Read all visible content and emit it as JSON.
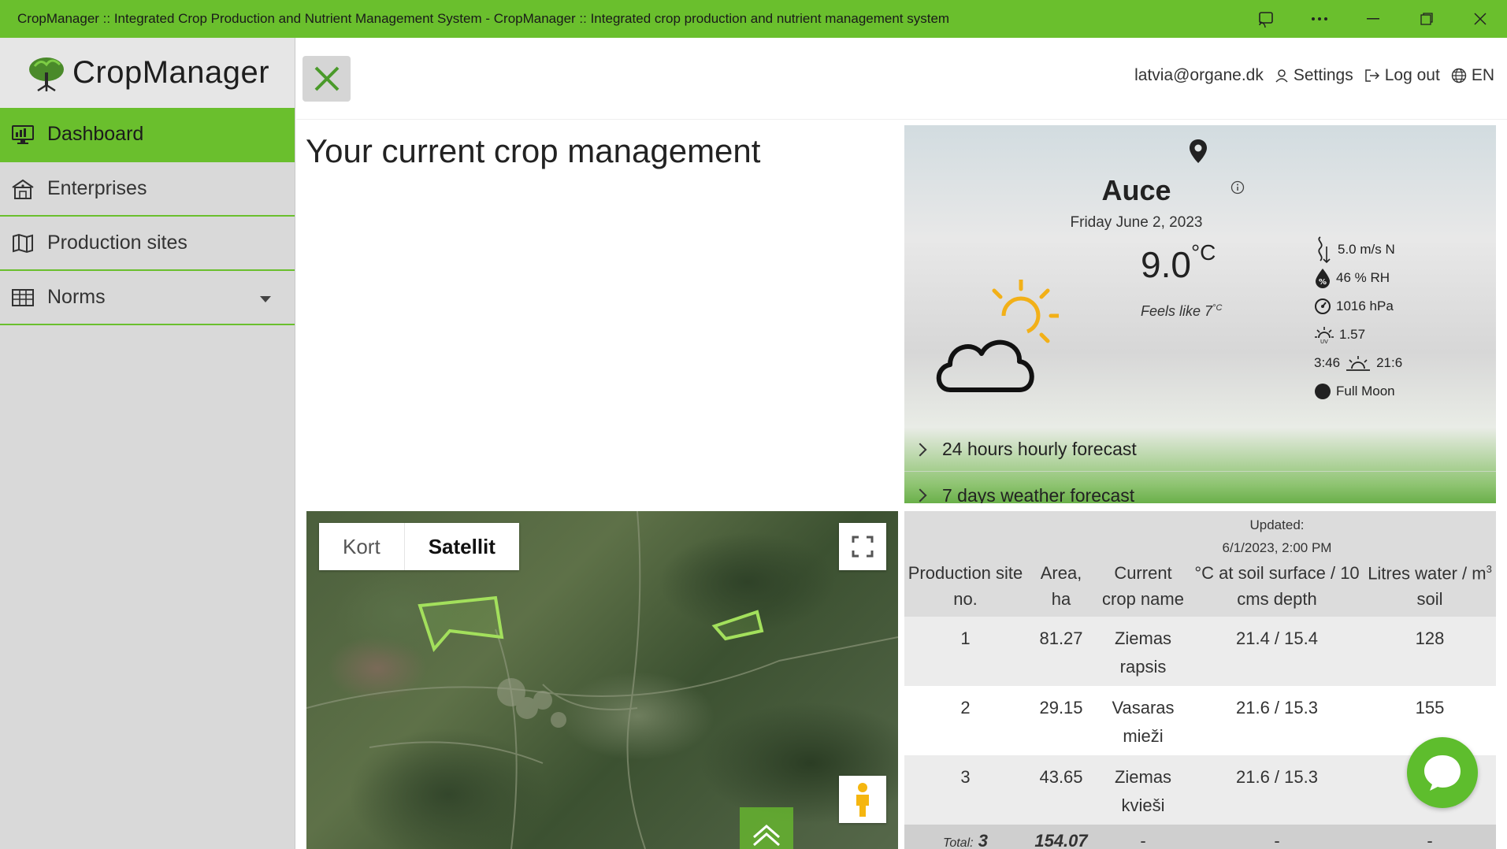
{
  "window": {
    "title": "CropManager :: Integrated Crop Production and Nutrient Management System - CropManager :: Integrated crop production and nutrient management system",
    "buttons": [
      "cast-icon",
      "more-icon",
      "minimize-icon",
      "maximize-icon",
      "close-icon"
    ]
  },
  "brand": {
    "name": "CropManager",
    "accent": "#6abf2d"
  },
  "sidebar": {
    "items": [
      {
        "label": "Dashboard",
        "icon": "dashboard-icon",
        "active": true
      },
      {
        "label": "Enterprises",
        "icon": "farm-icon"
      },
      {
        "label": "Production sites",
        "icon": "map-icon"
      },
      {
        "label": "Norms",
        "icon": "table-icon"
      }
    ]
  },
  "header": {
    "user": "latvia@organe.dk",
    "settings": "Settings",
    "logout": "Log out",
    "lang": "EN"
  },
  "page": {
    "title": "Your current crop management"
  },
  "weather": {
    "city": "Auce",
    "date": "Friday June 2, 2023",
    "temp": "9.0",
    "temp_unit": "°C",
    "feels_label": "Feels like 7",
    "feels_unit": "°C",
    "wind": "5.0 m/s N",
    "humidity": "46 % RH",
    "pressure": "1016 hPa",
    "uv": "1.57",
    "sunrise": "3:46",
    "sunset": "21:6",
    "moon": "Full Moon",
    "forecast_24h": "24 hours hourly forecast",
    "forecast_7d": "7 days weather forecast",
    "icon": "partly-cloudy-icon"
  },
  "map": {
    "tabs": [
      "Kort",
      "Satellit"
    ],
    "selected_tab": "Satellit"
  },
  "sites": {
    "updated_label": "Updated:",
    "updated_value": "6/1/2023, 2:00 PM",
    "headers": [
      "Production site no.",
      "Area, ha",
      "Current crop name",
      "°C at soil surface / 10 cms depth",
      "Litres water / m"
    ],
    "header_sup": "3",
    "header_soil": " soil",
    "rows": [
      [
        "1",
        "81.27",
        "Ziemas rapsis",
        "21.4 / 15.4",
        "128"
      ],
      [
        "2",
        "29.15",
        "Vasaras mieži",
        "21.6 / 15.3",
        "155"
      ],
      [
        "3",
        "43.65",
        "Ziemas kvieši",
        "21.6 / 15.3",
        ""
      ]
    ],
    "total_label": "Total:",
    "total_count": "3",
    "total_area": "154.07",
    "dash": "-"
  }
}
